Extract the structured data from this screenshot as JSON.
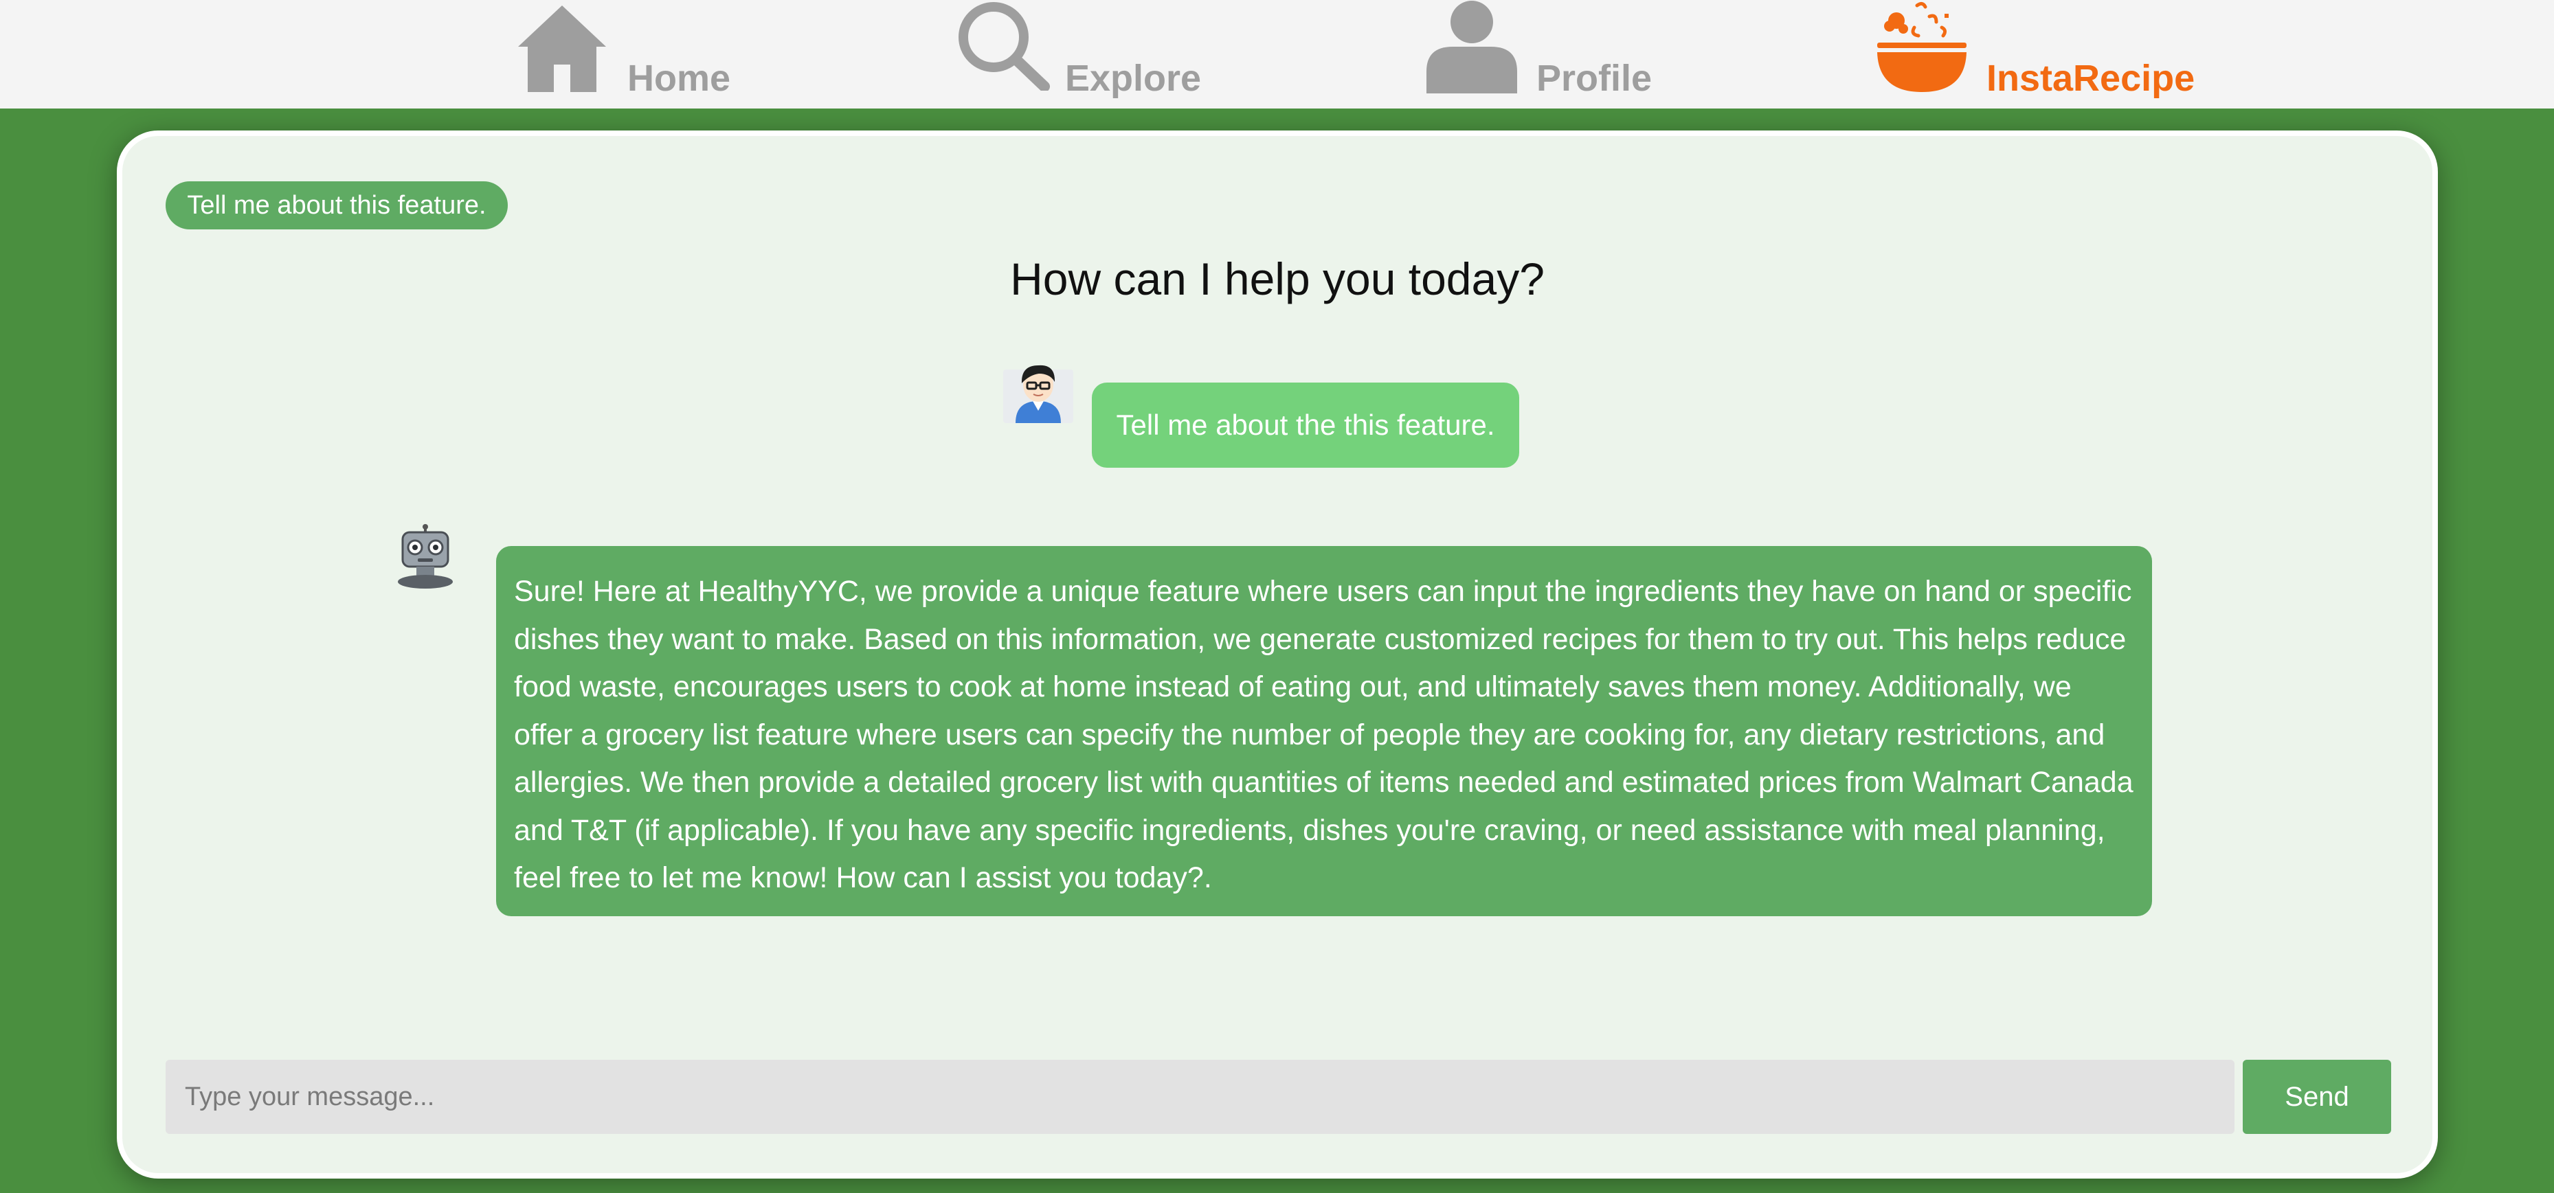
{
  "nav": {
    "items": [
      {
        "label": "Home",
        "icon": "home-icon"
      },
      {
        "label": "Explore",
        "icon": "search-icon"
      },
      {
        "label": "Profile",
        "icon": "user-icon"
      },
      {
        "label": "InstaRecipe",
        "icon": "bowl-icon",
        "active": true
      }
    ]
  },
  "chat": {
    "suggestion_chip": "Tell me about this feature.",
    "heading": "How can I help you today?",
    "messages": [
      {
        "sender": "user",
        "avatar": "user-avatar-icon",
        "text": "Tell me about the this feature."
      },
      {
        "sender": "bot",
        "avatar": "robot-avatar-icon",
        "text": "Sure! Here at HealthyYYC, we provide a unique feature where users can input the ingredients they have on hand or specific dishes they want to make. Based on this information, we generate customized recipes for them to try out. This helps reduce food waste, encourages users to cook at home instead of eating out, and ultimately saves them money. Additionally, we offer a grocery list feature where users can specify the number of people they are cooking for, any dietary restrictions, and allergies. We then provide a detailed grocery list with quantities of items needed and estimated prices from Walmart Canada and T&T (if applicable). If you have any specific ingredients, dishes you're craving, or need assistance with meal planning, feel free to let me know! How can I assist you today?."
      }
    ],
    "input": {
      "placeholder": "Type your message...",
      "value": ""
    },
    "send_label": "Send"
  },
  "colors": {
    "background": "#4a8f3f",
    "panel": "#ecf4eb",
    "accent_green": "#5fab63",
    "user_bubble": "#74d27b",
    "brand_orange": "#f26a12",
    "nav_gray": "#9e9e9e"
  }
}
